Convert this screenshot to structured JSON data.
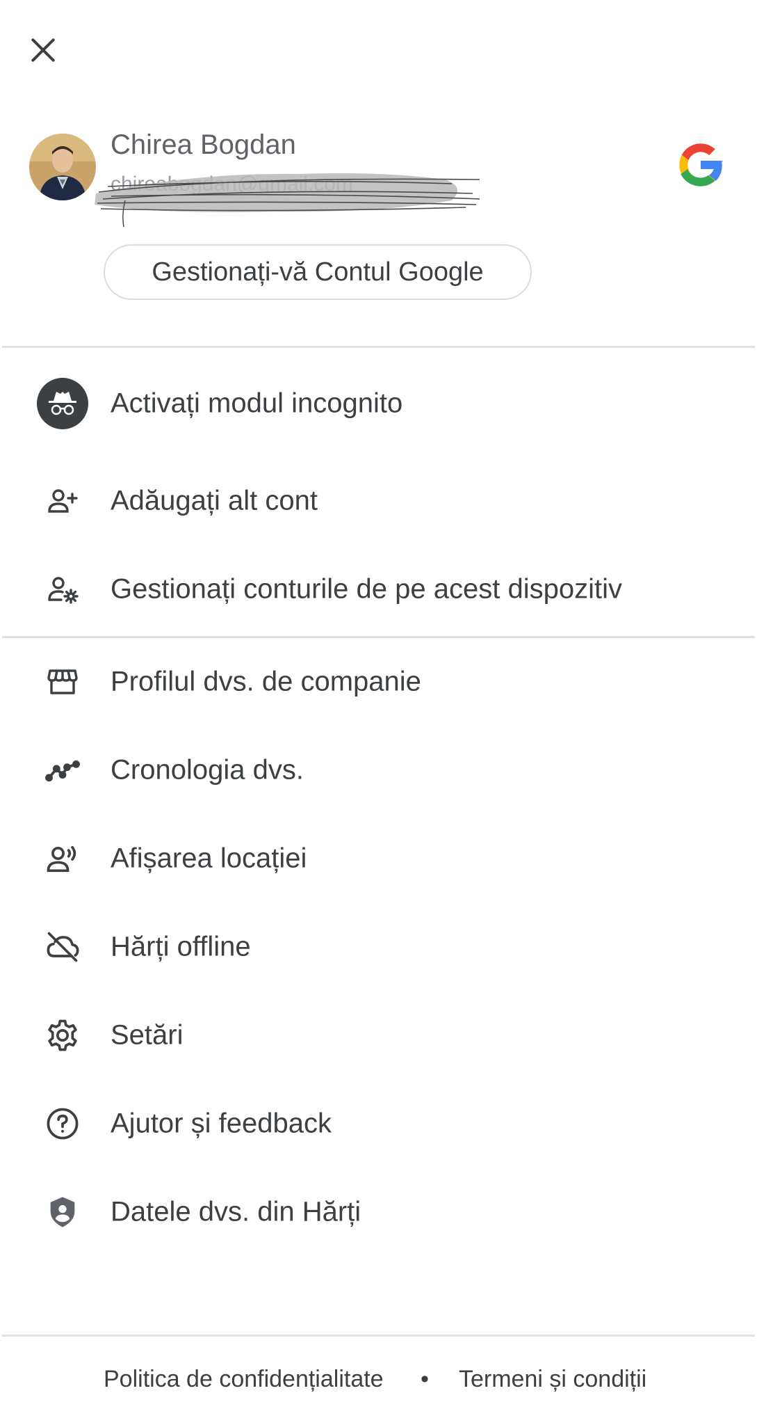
{
  "header": {
    "close_icon": "close-icon",
    "logo_icon": "google-g-logo"
  },
  "account": {
    "name": "Chirea Bogdan",
    "email": "chireabogdan@gmail.com",
    "manage_button": "Gestionați-vă Contul Google"
  },
  "menu_primary": [
    {
      "label": "Activați modul incognito",
      "icon": "incognito-icon"
    },
    {
      "label": "Adăugați alt cont",
      "icon": "add-person-icon"
    },
    {
      "label": "Gestionați conturile de pe acest dispozitiv",
      "icon": "manage-accounts-icon"
    }
  ],
  "menu_secondary": [
    {
      "label": "Profilul dvs. de companie",
      "icon": "storefront-icon"
    },
    {
      "label": "Cronologia dvs.",
      "icon": "timeline-icon"
    },
    {
      "label": "Afișarea locației",
      "icon": "location-sharing-icon"
    },
    {
      "label": "Hărți offline",
      "icon": "offline-cloud-icon"
    },
    {
      "label": "Setări",
      "icon": "gear-icon"
    },
    {
      "label": "Ajutor și feedback",
      "icon": "help-icon"
    },
    {
      "label": "Datele dvs. din Hărți",
      "icon": "privacy-shield-icon"
    }
  ],
  "footer": {
    "privacy": "Politica de confidențialitate",
    "separator": "•",
    "terms": "Termeni și condiții"
  },
  "colors": {
    "text_primary": "#3c4043",
    "icon": "#3c4043",
    "divider": "#e0e0e0",
    "incognito_bg": "#3c4043",
    "google_blue": "#4285F4",
    "google_red": "#EA4335",
    "google_yellow": "#FBBC05",
    "google_green": "#34A853"
  }
}
